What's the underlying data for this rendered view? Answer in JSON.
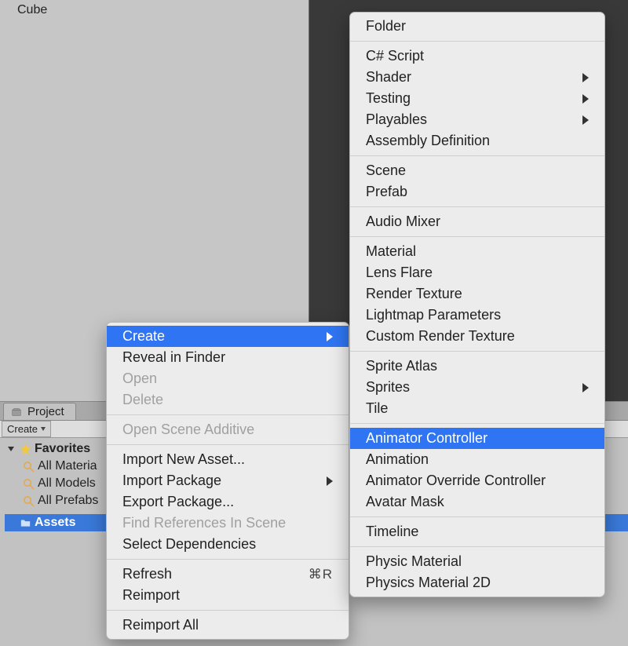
{
  "hierarchy": {
    "items": [
      "Cube"
    ]
  },
  "project": {
    "tab": "Project",
    "create_btn": "Create",
    "favorites_label": "Favorites",
    "favorites": [
      "All Materia",
      "All Models",
      "All Prefabs"
    ],
    "assets": "Assets"
  },
  "menu1": {
    "groups": [
      [
        {
          "label": "Create",
          "submenu": true,
          "highlight": true
        },
        {
          "label": "Reveal in Finder"
        },
        {
          "label": "Open",
          "disabled": true
        },
        {
          "label": "Delete",
          "disabled": true
        }
      ],
      [
        {
          "label": "Open Scene Additive",
          "disabled": true
        }
      ],
      [
        {
          "label": "Import New Asset..."
        },
        {
          "label": "Import Package",
          "submenu": true
        },
        {
          "label": "Export Package..."
        },
        {
          "label": "Find References In Scene",
          "disabled": true
        },
        {
          "label": "Select Dependencies"
        }
      ],
      [
        {
          "label": "Refresh",
          "shortcut": "⌘R"
        },
        {
          "label": "Reimport"
        }
      ],
      [
        {
          "label": "Reimport All"
        }
      ]
    ]
  },
  "menu2": {
    "groups": [
      [
        {
          "label": "Folder"
        }
      ],
      [
        {
          "label": "C# Script"
        },
        {
          "label": "Shader",
          "submenu": true
        },
        {
          "label": "Testing",
          "submenu": true
        },
        {
          "label": "Playables",
          "submenu": true
        },
        {
          "label": "Assembly Definition"
        }
      ],
      [
        {
          "label": "Scene"
        },
        {
          "label": "Prefab"
        }
      ],
      [
        {
          "label": "Audio Mixer"
        }
      ],
      [
        {
          "label": "Material"
        },
        {
          "label": "Lens Flare"
        },
        {
          "label": "Render Texture"
        },
        {
          "label": "Lightmap Parameters"
        },
        {
          "label": "Custom Render Texture"
        }
      ],
      [
        {
          "label": "Sprite Atlas"
        },
        {
          "label": "Sprites",
          "submenu": true
        },
        {
          "label": "Tile"
        }
      ],
      [
        {
          "label": "Animator Controller",
          "highlight": true
        },
        {
          "label": "Animation"
        },
        {
          "label": "Animator Override Controller"
        },
        {
          "label": "Avatar Mask"
        }
      ],
      [
        {
          "label": "Timeline"
        }
      ],
      [
        {
          "label": "Physic Material"
        },
        {
          "label": "Physics Material 2D"
        }
      ]
    ]
  }
}
